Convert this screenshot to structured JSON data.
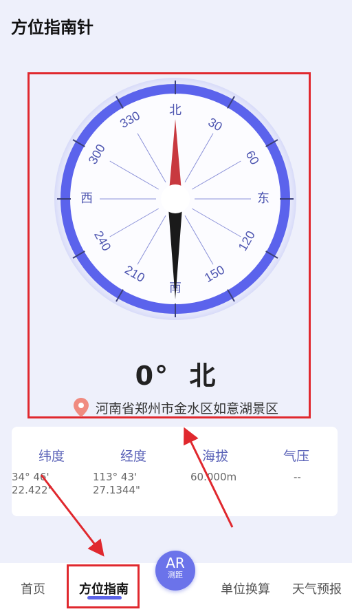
{
  "page_title": "方位指南针",
  "compass": {
    "north": "北",
    "east": "东",
    "south": "南",
    "west": "西",
    "degree_labels": [
      "30",
      "60",
      "120",
      "150",
      "210",
      "240",
      "300",
      "330"
    ],
    "needle_north_color": "#c8393f",
    "needle_south_color": "#1a1a1a",
    "ring_color": "#5b63ec"
  },
  "heading": {
    "degree": "0°",
    "direction": "北"
  },
  "location": {
    "icon": "location-pin-icon",
    "text": "河南省郑州市金水区如意湖景区"
  },
  "info": {
    "latitude": {
      "label": "纬度",
      "line1": "34° 46'",
      "line2": "22.422\""
    },
    "longitude": {
      "label": "经度",
      "line1": "113° 43'",
      "line2": "27.1344\""
    },
    "altitude": {
      "label": "海拔",
      "value": "60.000m"
    },
    "pressure": {
      "label": "气压",
      "value": "--"
    }
  },
  "nav": {
    "home": "首页",
    "compass": "方位指南",
    "ar_main": "AR",
    "ar_sub": "测距",
    "unit_convert": "单位换算",
    "weather": "天气预报"
  },
  "annotation_color": "#e0282e"
}
